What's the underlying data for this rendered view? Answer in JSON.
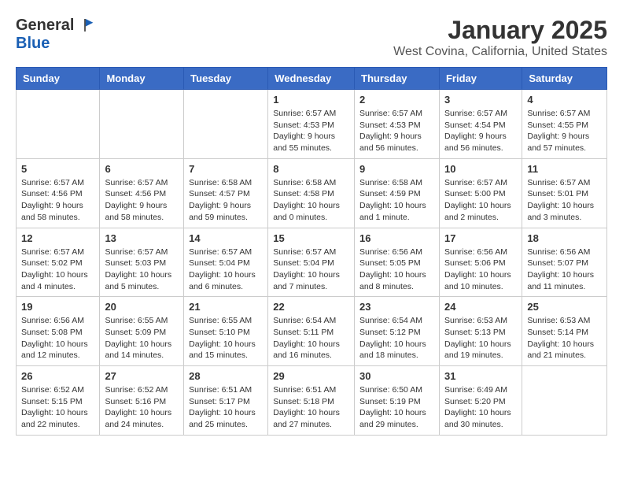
{
  "header": {
    "logo_general": "General",
    "logo_blue": "Blue",
    "month_title": "January 2025",
    "location": "West Covina, California, United States"
  },
  "calendar": {
    "days_of_week": [
      "Sunday",
      "Monday",
      "Tuesday",
      "Wednesday",
      "Thursday",
      "Friday",
      "Saturday"
    ],
    "weeks": [
      [
        {
          "day": "",
          "info": ""
        },
        {
          "day": "",
          "info": ""
        },
        {
          "day": "",
          "info": ""
        },
        {
          "day": "1",
          "info": "Sunrise: 6:57 AM\nSunset: 4:53 PM\nDaylight: 9 hours\nand 55 minutes."
        },
        {
          "day": "2",
          "info": "Sunrise: 6:57 AM\nSunset: 4:53 PM\nDaylight: 9 hours\nand 56 minutes."
        },
        {
          "day": "3",
          "info": "Sunrise: 6:57 AM\nSunset: 4:54 PM\nDaylight: 9 hours\nand 56 minutes."
        },
        {
          "day": "4",
          "info": "Sunrise: 6:57 AM\nSunset: 4:55 PM\nDaylight: 9 hours\nand 57 minutes."
        }
      ],
      [
        {
          "day": "5",
          "info": "Sunrise: 6:57 AM\nSunset: 4:56 PM\nDaylight: 9 hours\nand 58 minutes."
        },
        {
          "day": "6",
          "info": "Sunrise: 6:57 AM\nSunset: 4:56 PM\nDaylight: 9 hours\nand 58 minutes."
        },
        {
          "day": "7",
          "info": "Sunrise: 6:58 AM\nSunset: 4:57 PM\nDaylight: 9 hours\nand 59 minutes."
        },
        {
          "day": "8",
          "info": "Sunrise: 6:58 AM\nSunset: 4:58 PM\nDaylight: 10 hours\nand 0 minutes."
        },
        {
          "day": "9",
          "info": "Sunrise: 6:58 AM\nSunset: 4:59 PM\nDaylight: 10 hours\nand 1 minute."
        },
        {
          "day": "10",
          "info": "Sunrise: 6:57 AM\nSunset: 5:00 PM\nDaylight: 10 hours\nand 2 minutes."
        },
        {
          "day": "11",
          "info": "Sunrise: 6:57 AM\nSunset: 5:01 PM\nDaylight: 10 hours\nand 3 minutes."
        }
      ],
      [
        {
          "day": "12",
          "info": "Sunrise: 6:57 AM\nSunset: 5:02 PM\nDaylight: 10 hours\nand 4 minutes."
        },
        {
          "day": "13",
          "info": "Sunrise: 6:57 AM\nSunset: 5:03 PM\nDaylight: 10 hours\nand 5 minutes."
        },
        {
          "day": "14",
          "info": "Sunrise: 6:57 AM\nSunset: 5:04 PM\nDaylight: 10 hours\nand 6 minutes."
        },
        {
          "day": "15",
          "info": "Sunrise: 6:57 AM\nSunset: 5:04 PM\nDaylight: 10 hours\nand 7 minutes."
        },
        {
          "day": "16",
          "info": "Sunrise: 6:56 AM\nSunset: 5:05 PM\nDaylight: 10 hours\nand 8 minutes."
        },
        {
          "day": "17",
          "info": "Sunrise: 6:56 AM\nSunset: 5:06 PM\nDaylight: 10 hours\nand 10 minutes."
        },
        {
          "day": "18",
          "info": "Sunrise: 6:56 AM\nSunset: 5:07 PM\nDaylight: 10 hours\nand 11 minutes."
        }
      ],
      [
        {
          "day": "19",
          "info": "Sunrise: 6:56 AM\nSunset: 5:08 PM\nDaylight: 10 hours\nand 12 minutes."
        },
        {
          "day": "20",
          "info": "Sunrise: 6:55 AM\nSunset: 5:09 PM\nDaylight: 10 hours\nand 14 minutes."
        },
        {
          "day": "21",
          "info": "Sunrise: 6:55 AM\nSunset: 5:10 PM\nDaylight: 10 hours\nand 15 minutes."
        },
        {
          "day": "22",
          "info": "Sunrise: 6:54 AM\nSunset: 5:11 PM\nDaylight: 10 hours\nand 16 minutes."
        },
        {
          "day": "23",
          "info": "Sunrise: 6:54 AM\nSunset: 5:12 PM\nDaylight: 10 hours\nand 18 minutes."
        },
        {
          "day": "24",
          "info": "Sunrise: 6:53 AM\nSunset: 5:13 PM\nDaylight: 10 hours\nand 19 minutes."
        },
        {
          "day": "25",
          "info": "Sunrise: 6:53 AM\nSunset: 5:14 PM\nDaylight: 10 hours\nand 21 minutes."
        }
      ],
      [
        {
          "day": "26",
          "info": "Sunrise: 6:52 AM\nSunset: 5:15 PM\nDaylight: 10 hours\nand 22 minutes."
        },
        {
          "day": "27",
          "info": "Sunrise: 6:52 AM\nSunset: 5:16 PM\nDaylight: 10 hours\nand 24 minutes."
        },
        {
          "day": "28",
          "info": "Sunrise: 6:51 AM\nSunset: 5:17 PM\nDaylight: 10 hours\nand 25 minutes."
        },
        {
          "day": "29",
          "info": "Sunrise: 6:51 AM\nSunset: 5:18 PM\nDaylight: 10 hours\nand 27 minutes."
        },
        {
          "day": "30",
          "info": "Sunrise: 6:50 AM\nSunset: 5:19 PM\nDaylight: 10 hours\nand 29 minutes."
        },
        {
          "day": "31",
          "info": "Sunrise: 6:49 AM\nSunset: 5:20 PM\nDaylight: 10 hours\nand 30 minutes."
        },
        {
          "day": "",
          "info": ""
        }
      ]
    ]
  }
}
